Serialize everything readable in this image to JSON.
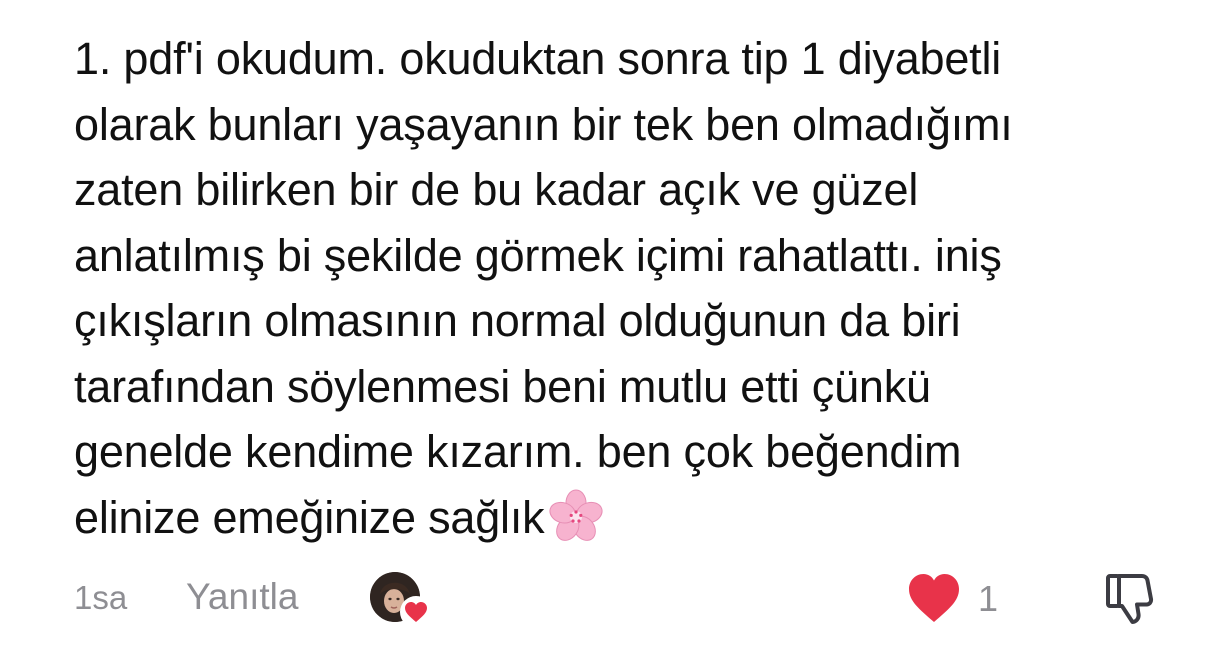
{
  "comment": {
    "lines": [
      "1. pdf'i okudum. okuduktan sonra tip 1 diyabetli",
      "olarak bunları yaşayanın bir tek ben olmadığımı",
      "zaten bilirken bir de bu kadar açık ve güzel",
      "anlatılmış bi şekilde görmek içimi rahatlattı. iniş",
      "çıkışların olmasının normal olduğunun da biri",
      "tarafından söylenmesi beni mutlu etti çünkü",
      "genelde kendime kızarım. ben çok beğendim",
      "elinize emeğinize sağlık"
    ],
    "emoji": "cherry-blossom"
  },
  "footer": {
    "timestamp": "1sa",
    "reply_label": "Yanıtla",
    "like_count": "1"
  },
  "icons": {
    "like": "heart-icon",
    "dislike": "thumbs-down-icon",
    "avatar_badge": "heart-icon"
  },
  "colors": {
    "text": "#111111",
    "muted": "#8e8e93",
    "heart": "#e8334a",
    "blossom": "#f7b3cf"
  }
}
